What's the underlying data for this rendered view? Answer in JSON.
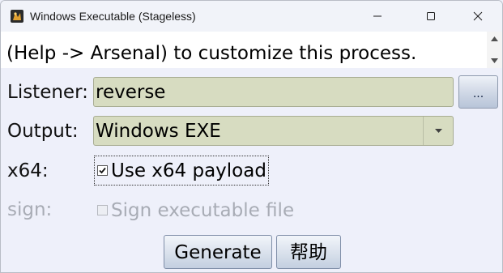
{
  "window": {
    "title": "Windows Executable (Stageless)",
    "controls": {
      "minimize": "minimize",
      "maximize": "maximize",
      "close": "close"
    }
  },
  "description": {
    "partial_line": "",
    "line2": "(Help -> Arsenal) to customize this process."
  },
  "form": {
    "listener": {
      "label": "Listener:",
      "value": "reverse",
      "browse_label": "..."
    },
    "output": {
      "label": "Output:",
      "value": "Windows EXE"
    },
    "x64": {
      "label": "x64:",
      "checkbox_label": "Use x64 payload",
      "checked": true
    },
    "sign": {
      "label": "sign:",
      "checkbox_label": "Sign executable file",
      "checked": false,
      "enabled": false
    }
  },
  "buttons": {
    "generate": "Generate",
    "help": "帮助"
  },
  "colors": {
    "field_bg": "#d7dcc1",
    "window_bg": "#eef0fa"
  }
}
